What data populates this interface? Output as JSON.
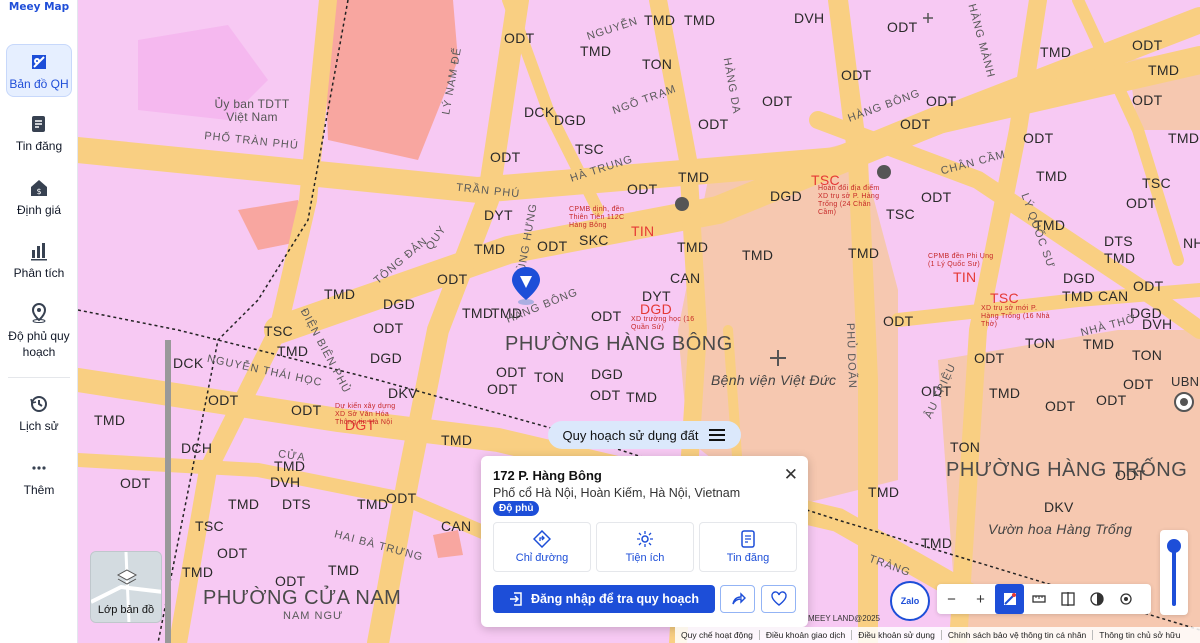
{
  "brand": "Meey Map",
  "sidebar": {
    "items": [
      {
        "label": "Bản đồ QH",
        "icon": "map-planning-icon"
      },
      {
        "label": "Tin đăng",
        "icon": "listing-icon"
      },
      {
        "label": "Định giá",
        "icon": "valuation-icon"
      },
      {
        "label": "Phân tích",
        "icon": "analytics-icon"
      },
      {
        "label": "Độ phủ quy hoạch",
        "icon": "coverage-pin-icon"
      },
      {
        "label": "Lịch sử",
        "icon": "history-icon"
      },
      {
        "label": "Thêm",
        "icon": "more-icon"
      }
    ]
  },
  "map": {
    "wards": [
      "PHƯỜNG HÀNG BÔNG",
      "PHƯỜNG CỬA NAM",
      "PHƯỜNG HÀNG TRỐNG"
    ],
    "places": [
      "Bệnh viện Việt Đức",
      "Vườn hoa Hàng Trống",
      "Ủy ban TDTT Việt Nam",
      "UBND C"
    ],
    "streets": [
      "NGUYỄN",
      "NGÕ TRẠM",
      "HÀNG DA",
      "PHỐ TRÀN PHÚ",
      "TRẦN PHÚ",
      "HÀ TRUNG",
      "PHÙNG HƯNG",
      "HÀNG BÔNG",
      "ĐIỆN BIÊN PHỦ",
      "NGUYỄN THÁI HỌC",
      "CỬA",
      "HAI BÀ TRƯNG",
      "NAM NGƯ",
      "TRÀNG",
      "LÝ NAM ĐẾ",
      "TÔNG ĐẢN",
      "CHÂN CẦM",
      "LÝ QUỐC SƯ",
      "NHÀ THỜ",
      "PHỦ DOÃN",
      "ÂU TRIỆU",
      "HÀNG MÀNH",
      "HÀNG BÔNG",
      "QUY"
    ],
    "labels": [
      "ODT",
      "TMD",
      "DGD",
      "TSC",
      "TON",
      "DVH",
      "DCK",
      "SKC",
      "DYT",
      "CAN",
      "DKV",
      "DTS",
      "DCH",
      "NHA"
    ],
    "red_labels": [
      "TSC",
      "TIN",
      "DGD",
      "DGT",
      "TIN",
      "TSC"
    ],
    "annotations": {
      "a1": "CPMB dịnh, đền Thiên Tiên 112C Hàng Bông",
      "a2": "Hoàn đổi địa điểm XD trụ sở P. Hàng Trống (24 Chân Cầm)",
      "a3": "XD trường học (16 Quần Sứ)",
      "a4": "CPMB đền Phi Ụng (1 Lý Quốc Sư)",
      "a5": "XD trụ sở mới P. Hàng Trống (16 Nhà Thờ)",
      "a6": "Dự kiến xây dựng XD Sở Văn Hóa Thông tin Hà Nội"
    }
  },
  "pill": {
    "label": "Quy hoạch sử dụng đất"
  },
  "popup": {
    "title": "172 P. Hàng Bông",
    "address": "Phố cổ Hà Nội, Hoàn Kiếm, Hà Nội, Vietnam",
    "badge": "Độ phủ",
    "actions": [
      {
        "label": "Chỉ đường",
        "icon": "directions-icon"
      },
      {
        "label": "Tiện ích",
        "icon": "amenities-icon"
      },
      {
        "label": "Tin đăng",
        "icon": "listing-icon"
      }
    ],
    "login_button": "Đăng nhập để tra quy hoạch"
  },
  "layer_button": {
    "label": "Lớp bản đồ"
  },
  "zalo": {
    "label": "Zalo"
  },
  "toolbar": {
    "zoom_out": "−",
    "zoom_in": "+"
  },
  "copyright": "MEEY LAND@2025",
  "footer": [
    "Quy chế hoạt động",
    "Điều khoản giao dịch",
    "Điều khoản sử dụng",
    "Chính sách bảo vệ thông tin cá nhân",
    "Thông tin chủ sở hữu"
  ],
  "colors": {
    "accent": "#1d4ed8",
    "residential": "#f7c9f3",
    "road": "#f9cf82",
    "public": "#f8a6a0",
    "institutional": "#f6c8b0"
  }
}
